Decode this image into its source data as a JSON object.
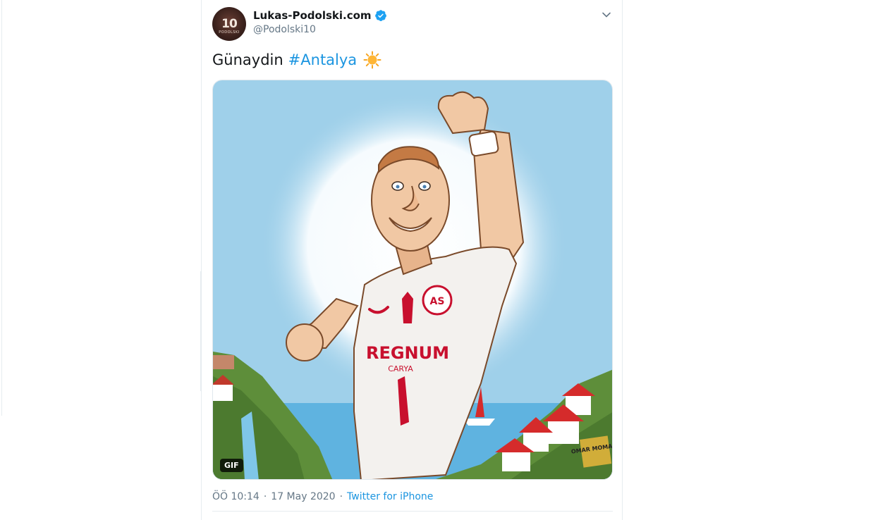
{
  "tweet": {
    "display_name": "Lukas-Podolski.com",
    "handle": "@Podolski10",
    "avatar_number": "10",
    "avatar_caption": "PODOLSKI",
    "text_prefix": "Günaydin",
    "hashtag": "#Antalya",
    "media": {
      "badge": "GIF",
      "jersey_sponsor": "REGNUM",
      "jersey_sponsor_sub": "CARYA",
      "crest_text": "AS",
      "signature": "OMAR MOMANI"
    },
    "time": "ÖÖ 10:14",
    "date": "17 May 2020",
    "source": "Twitter for iPhone",
    "separator": "·"
  },
  "icons": {
    "verified": "verified-badge-icon",
    "menu": "chevron-down-icon",
    "emoji": "sun-emoji-icon"
  },
  "colors": {
    "link": "#1b95e0",
    "text": "#14171a",
    "secondary": "#657786",
    "border": "#e6ecf0",
    "sky": "#a8d4eb",
    "jersey_red": "#c8102e"
  }
}
